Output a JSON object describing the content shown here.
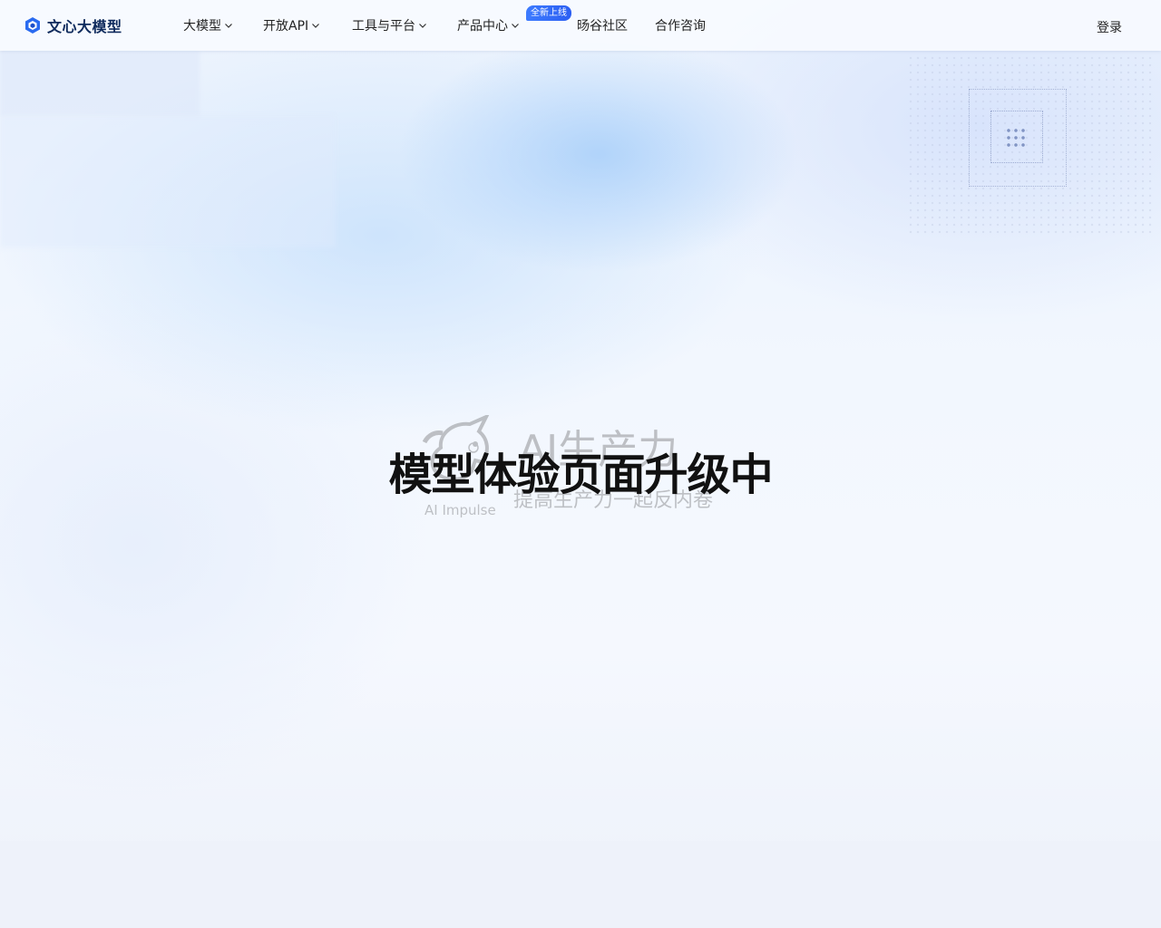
{
  "header": {
    "logo_text": "文心大模型",
    "nav": [
      {
        "label": "大模型",
        "has_dropdown": true
      },
      {
        "label": "开放API",
        "has_dropdown": true
      },
      {
        "label": "工具与平台",
        "has_dropdown": true
      },
      {
        "label": "产品中心",
        "has_dropdown": true
      },
      {
        "label": "旸谷社区",
        "has_dropdown": false
      },
      {
        "label": "合作咨询",
        "has_dropdown": false
      }
    ],
    "badge": "全新上线",
    "login_label": "登录"
  },
  "main": {
    "title": "模型体验页面升级中",
    "watermark": {
      "headline": "AI生产力",
      "slogan": "提高生产力一起反内卷",
      "brand": "AI Impulse"
    }
  },
  "colors": {
    "brand_navy": "#0e2a5c",
    "badge_blue": "#2c5ff2",
    "logo_blue": "#2a6bf0"
  }
}
